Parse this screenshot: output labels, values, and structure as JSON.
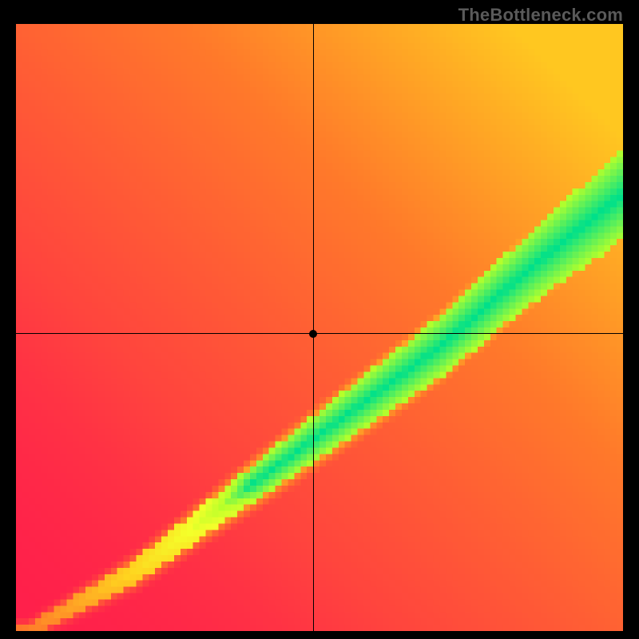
{
  "watermark": "TheBottleneck.com",
  "chart_data": {
    "type": "heatmap",
    "title": "",
    "xlabel": "",
    "ylabel": "",
    "xlim": [
      0,
      1
    ],
    "ylim": [
      0,
      1
    ],
    "grid": false,
    "legend": false,
    "marker": {
      "x": 0.49,
      "y": 0.49
    },
    "crosshair": {
      "x": 0.49,
      "y": 0.49
    },
    "color_stops": [
      {
        "value": 0.0,
        "color": "#ff1f4b"
      },
      {
        "value": 0.4,
        "color": "#ff7a2a"
      },
      {
        "value": 0.65,
        "color": "#ffd21f"
      },
      {
        "value": 0.82,
        "color": "#f4ff2a"
      },
      {
        "value": 0.92,
        "color": "#b7ff2a"
      },
      {
        "value": 1.0,
        "color": "#00e08a"
      }
    ],
    "ridge": {
      "description": "Green optimal band runs diagonally from bottom-left to upper-right, centered roughly along y ≈ 0.72·x − 0.02 (in [0,1] axis units), widening toward the top-right.",
      "anchors_xy": [
        [
          0.02,
          0.0
        ],
        [
          0.2,
          0.1
        ],
        [
          0.4,
          0.25
        ],
        [
          0.55,
          0.36
        ],
        [
          0.7,
          0.47
        ],
        [
          0.85,
          0.6
        ],
        [
          1.0,
          0.72
        ]
      ],
      "half_width_at_x": [
        [
          0.02,
          0.01
        ],
        [
          0.3,
          0.025
        ],
        [
          0.6,
          0.045
        ],
        [
          0.85,
          0.06
        ],
        [
          1.0,
          0.075
        ]
      ]
    },
    "grid_resolution": 96
  }
}
